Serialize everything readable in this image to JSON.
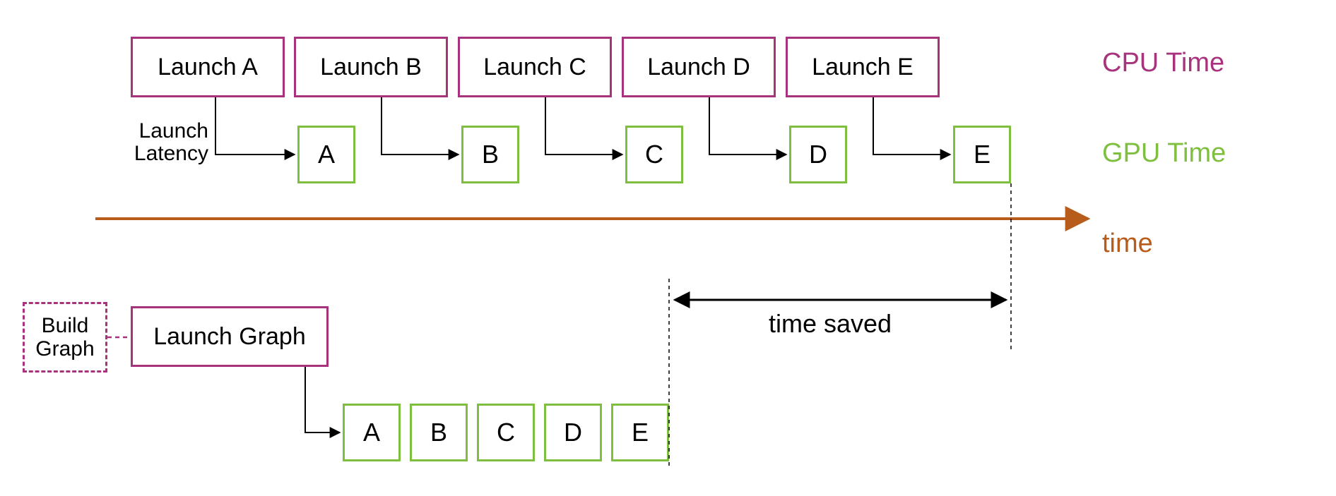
{
  "legend": {
    "cpu": "CPU Time",
    "gpu": "GPU Time",
    "time_axis": "time"
  },
  "labels": {
    "launch_latency_line1": "Launch",
    "launch_latency_line2": "Latency",
    "time_saved": "time saved",
    "build_graph_line1": "Build",
    "build_graph_line2": "Graph"
  },
  "top": {
    "cpu_launches": [
      "Launch A",
      "Launch B",
      "Launch C",
      "Launch D",
      "Launch E"
    ],
    "gpu_kernels": [
      "A",
      "B",
      "C",
      "D",
      "E"
    ]
  },
  "bottom": {
    "build_graph": "Build Graph",
    "cpu_launch": "Launch Graph",
    "gpu_kernels": [
      "A",
      "B",
      "C",
      "D",
      "E"
    ]
  },
  "colors": {
    "cpu": "#a8337d",
    "gpu": "#7fbf3f",
    "time": "#b85c1c"
  },
  "diagram": {
    "description": "Comparison of per-kernel CPU launch (with per-launch latency) vs. a single Launch Graph call; the graph approach eliminates repeated launch latency, yielding a 'time saved' interval.",
    "kernels": [
      "A",
      "B",
      "C",
      "D",
      "E"
    ]
  }
}
